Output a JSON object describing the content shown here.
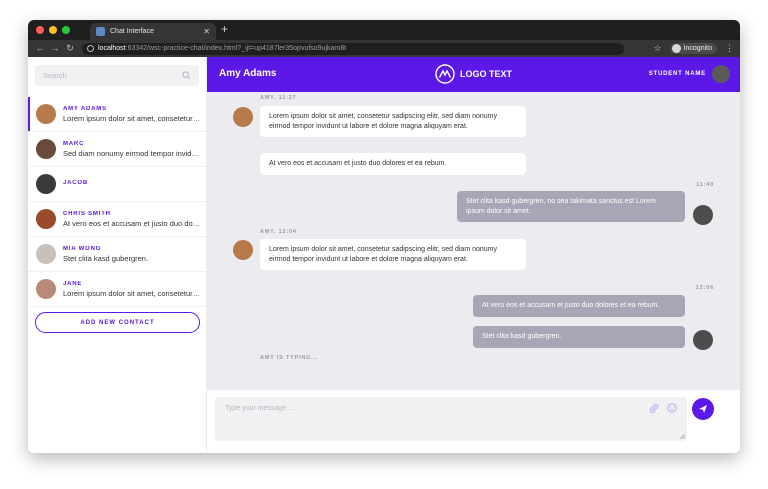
{
  "browser": {
    "tab_title": "Chat Interface",
    "url_host": "localhost",
    "url_path": ":63342/wsc-practice-chat/index.html?_ijt=up4187ler35opvufso9ujkam8t",
    "incognito_label": "Incognito"
  },
  "sidebar": {
    "search_placeholder": "Search",
    "contacts": [
      {
        "name": "AMY ADAMS",
        "message": "Lorem ipsum dolor sit amet, consetetur sadipscing",
        "color": "#b77a4a"
      },
      {
        "name": "MARC",
        "message": "Sed diam nonumy eirmod tempor invidunt",
        "color": "#6a4a3a"
      },
      {
        "name": "JACOB",
        "message": "",
        "color": "#3a3a3a"
      },
      {
        "name": "CHRIS SMITH",
        "message": "At vero eos et accusam et justo duo dolores",
        "color": "#9b4a2a"
      },
      {
        "name": "MIA WONG",
        "message": "Stet clita kasd gubergren.",
        "color": "#c7c0bb"
      },
      {
        "name": "JANE",
        "message": "Lorem ipsum dolor sit amet, consetetur sadipscing",
        "color": "#b88a7a"
      }
    ],
    "add_button": "ADD NEW CONTACT"
  },
  "header": {
    "contact_name": "Amy Adams",
    "logo_text": "LOGO TEXT",
    "student_label": "STUDENT NAME"
  },
  "messages": {
    "meta1": "AMY, 11:27",
    "in1": "Lorem ipsum dolor sit amet, consetetur sadipscing elitr, sed diam nonumy eirmod tempor invidunt ut labore et dolore magna aliquyam erat.",
    "in2": "At vero eos et accusam et justo duo dolores et ea rebum.",
    "time1": "11:40",
    "out1": "Stet clita kasd gubergren, no sea takimata sanctus est Lorem ipsum dolor sit amet.",
    "meta2": "AMY, 12:04",
    "in3": "Lorem ipsum dolor sit amet, consetetur sadipscing elitr, sed diam nonumy eirmod tempor invidunt ut labore et dolore magna aliquyam erat.",
    "time2": "12:06",
    "out2": "At vero eos et accusam et justo duo dolores et ea rebum.",
    "out3": "Stet clita kasd gubergren.",
    "typing": "AMY IS TYPING..."
  },
  "composer": {
    "placeholder": "Type your message ..."
  },
  "colors": {
    "accent": "#5b18e6",
    "outgoing": "#a9a5b6",
    "background": "#ececf0"
  }
}
